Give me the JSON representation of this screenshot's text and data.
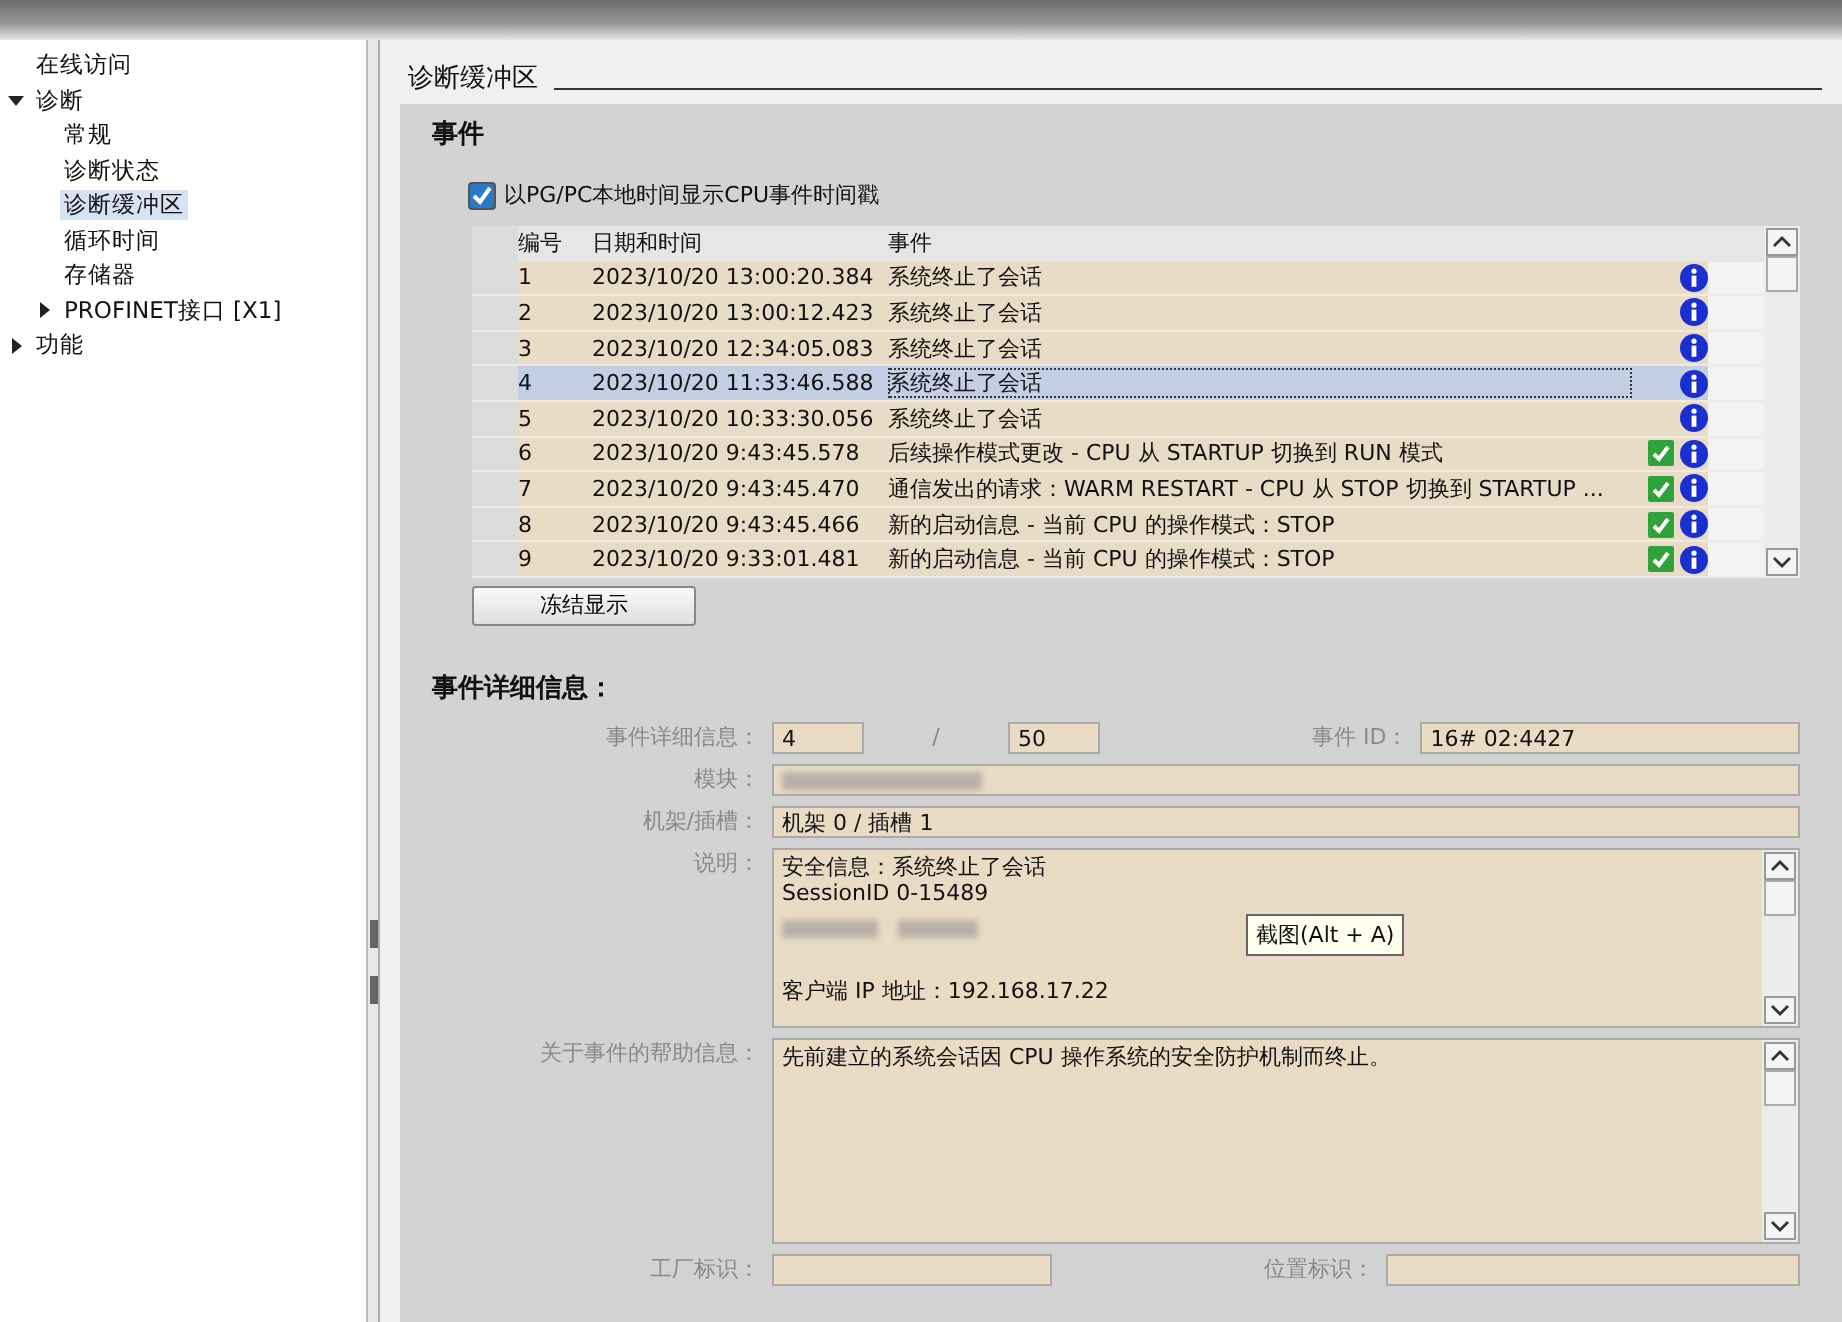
{
  "sidebar": {
    "items": [
      {
        "label": "在线访问",
        "selected": false
      },
      {
        "label": "诊断",
        "selected": false,
        "expanded": true,
        "children": [
          {
            "label": "常规",
            "selected": false
          },
          {
            "label": "诊断状态",
            "selected": false
          },
          {
            "label": "诊断缓冲区",
            "selected": true
          },
          {
            "label": "循环时间",
            "selected": false
          },
          {
            "label": "存储器",
            "selected": false
          },
          {
            "label": "PROFINET接口 [X1]",
            "selected": false,
            "expanded": false
          }
        ]
      },
      {
        "label": "功能",
        "selected": false,
        "expanded": false
      }
    ]
  },
  "page_title": "诊断缓冲区",
  "events_section": {
    "title": "事件",
    "timestamp_option": {
      "label": "以PG/PC本地时间显示CPU事件时间戳",
      "checked": true
    },
    "table": {
      "columns": [
        "编号",
        "日期和时间",
        "事件"
      ],
      "rows": [
        {
          "number": "1",
          "datetime": "2023/10/20 13:00:20.384",
          "event": "系统终止了会话",
          "ok": false,
          "selected": false
        },
        {
          "number": "2",
          "datetime": "2023/10/20 13:00:12.423",
          "event": "系统终止了会话",
          "ok": false,
          "selected": false
        },
        {
          "number": "3",
          "datetime": "2023/10/20 12:34:05.083",
          "event": "系统终止了会话",
          "ok": false,
          "selected": false
        },
        {
          "number": "4",
          "datetime": "2023/10/20 11:33:46.588",
          "event": "系统终止了会话",
          "ok": false,
          "selected": true
        },
        {
          "number": "5",
          "datetime": "2023/10/20 10:33:30.056",
          "event": "系统终止了会话",
          "ok": false,
          "selected": false
        },
        {
          "number": "6",
          "datetime": "2023/10/20 9:43:45.578",
          "event": "后续操作模式更改 - CPU 从 STARTUP 切换到 RUN 模式",
          "ok": true,
          "selected": false
        },
        {
          "number": "7",
          "datetime": "2023/10/20 9:43:45.470",
          "event": "通信发出的请求：WARM RESTART - CPU 从 STOP 切换到 STARTUP ...",
          "ok": true,
          "selected": false
        },
        {
          "number": "8",
          "datetime": "2023/10/20 9:43:45.466",
          "event": "新的启动信息 - 当前 CPU 的操作模式：STOP",
          "ok": true,
          "selected": false
        },
        {
          "number": "9",
          "datetime": "2023/10/20 9:33:01.481",
          "event": "新的启动信息 - 当前 CPU 的操作模式：STOP",
          "ok": true,
          "selected": false
        }
      ]
    },
    "freeze_button": "冻结显示"
  },
  "details": {
    "title": "事件详细信息：",
    "detail_label": "事件详细信息：",
    "detail_index": "4",
    "separator": "/",
    "detail_total": "50",
    "event_id_label": "事件 ID：",
    "event_id": "16# 02:4427",
    "module_label": "模块：",
    "rack_slot_label": "机架/插槽：",
    "rack_slot": "机架 0 / 插槽 1",
    "description_label": "说明：",
    "description_lines": [
      "安全信息：系统终止了会话",
      " SessionID 0-15489",
      "客户端 IP 地址：192.168.17.22"
    ],
    "help_label": "关于事件的帮助信息：",
    "help_text": "先前建立的系统会话因 CPU 操作系统的安全防护机制而终止。",
    "plant_label": "工厂标识：",
    "location_label": "位置标识："
  },
  "tooltip": "截图(Alt + A)"
}
